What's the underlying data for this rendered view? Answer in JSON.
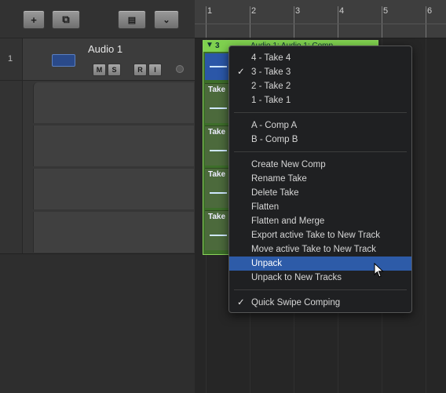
{
  "toolbar": {
    "add_track_symbol": "+",
    "duplicate_symbol": "⧉",
    "view_symbols": [
      "▤",
      "⌄"
    ]
  },
  "track": {
    "number": "1",
    "name": "Audio 1",
    "buttons": [
      "M",
      "S",
      "R",
      "I"
    ]
  },
  "ruler": {
    "bars": [
      "1",
      "2",
      "3",
      "4",
      "5",
      "6"
    ]
  },
  "take_folder": {
    "header_text": "Audio 1: Audio 1: Comp",
    "current_take": "3",
    "take_lane_label": "Take"
  },
  "context_menu": {
    "takes": [
      {
        "label": "4 - Take 4",
        "checked": false
      },
      {
        "label": "3 - Take 3",
        "checked": true
      },
      {
        "label": "2 - Take 2",
        "checked": false
      },
      {
        "label": "1 - Take 1",
        "checked": false
      }
    ],
    "comps": [
      {
        "label": "A - Comp A"
      },
      {
        "label": "B - Comp B"
      }
    ],
    "actions": [
      {
        "label": "Create New Comp"
      },
      {
        "label": "Rename Take"
      },
      {
        "label": "Delete Take"
      },
      {
        "label": "Flatten"
      },
      {
        "label": "Flatten and Merge"
      },
      {
        "label": "Export active Take to New Track"
      },
      {
        "label": "Move active Take to New Track"
      },
      {
        "label": "Unpack",
        "highlighted": true
      },
      {
        "label": "Unpack to New Tracks"
      }
    ],
    "options": [
      {
        "label": "Quick Swipe Comping",
        "checked": true
      }
    ],
    "check_mark": "✓"
  },
  "colors": {
    "take_green": "#7fd14f",
    "menu_highlight": "#2d5ba8"
  }
}
